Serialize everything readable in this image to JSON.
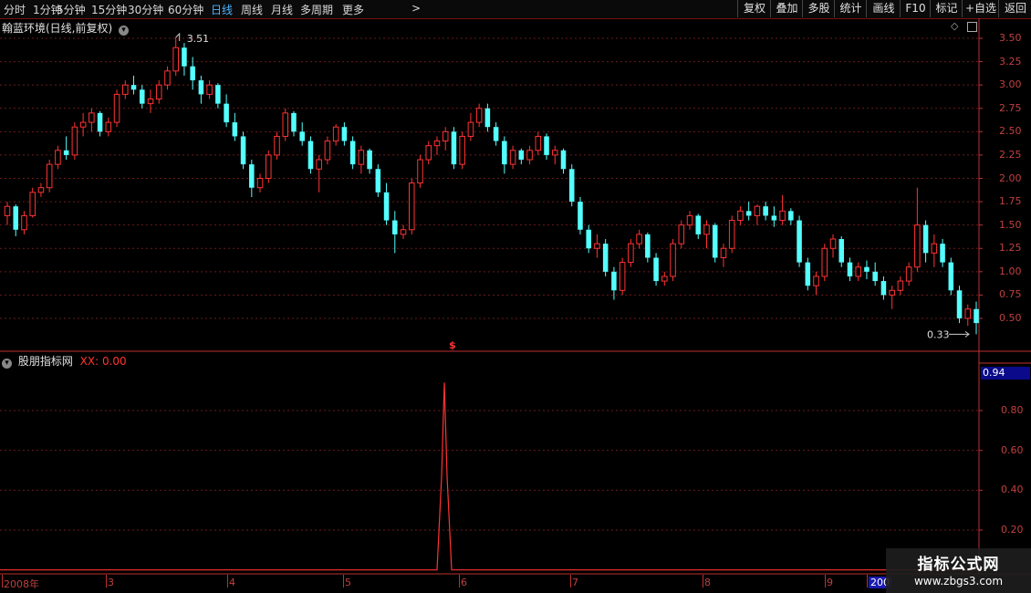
{
  "toolbar": {
    "periods": [
      {
        "label": "分时"
      },
      {
        "label": "1分钟"
      },
      {
        "label": "5分钟"
      },
      {
        "label": "15分钟"
      },
      {
        "label": "30分钟"
      },
      {
        "label": "60分钟"
      },
      {
        "label": "日线",
        "active": true
      },
      {
        "label": "周线"
      },
      {
        "label": "月线"
      },
      {
        "label": "多周期"
      },
      {
        "label": "更多"
      }
    ],
    "buttons": [
      "复权",
      "叠加",
      "多股",
      "统计",
      "画线",
      "F10",
      "标记",
      "+自选",
      "返回"
    ],
    "more_arrow": ">"
  },
  "main_chart": {
    "title": "翰蓝环境(日线,前复权)",
    "high_marker": "3.51",
    "low_marker": "0.33",
    "event_marker": "$",
    "axis_ticks": [
      "3.50",
      "3.25",
      "3.00",
      "2.75",
      "2.50",
      "2.25",
      "2.00",
      "1.75",
      "1.50",
      "1.25",
      "1.00",
      "0.75",
      "0.50"
    ]
  },
  "indicator": {
    "title": "股朋指标网",
    "xx_label": "XX: 0.00",
    "current_value": "0.94",
    "axis_ticks": [
      "0.80",
      "0.60",
      "0.40",
      "0.20"
    ]
  },
  "timeline": {
    "labels": [
      "2008年",
      "3",
      "4",
      "5",
      "6",
      "7",
      "8",
      "9",
      "200"
    ]
  },
  "watermark": {
    "title": "指标公式网",
    "url": "www.zbgs3.com"
  },
  "colors": {
    "up": "#ff3333",
    "down": "#54ffff",
    "grid": "#6b1a1a",
    "axis": "#c03030",
    "active_period": "#4fb3ff"
  },
  "chart_data": {
    "type": "candlestick",
    "price_range": [
      0.25,
      3.6
    ],
    "indicator_range": [
      0,
      1.0
    ],
    "indicator_peak": 0.94,
    "candles": [
      [
        1.6,
        1.75,
        1.5,
        1.7
      ],
      [
        1.7,
        1.72,
        1.38,
        1.45
      ],
      [
        1.45,
        1.65,
        1.4,
        1.6
      ],
      [
        1.6,
        1.9,
        1.58,
        1.85
      ],
      [
        1.85,
        1.95,
        1.8,
        1.9
      ],
      [
        1.9,
        2.2,
        1.85,
        2.15
      ],
      [
        2.15,
        2.35,
        2.1,
        2.3
      ],
      [
        2.3,
        2.45,
        2.2,
        2.25
      ],
      [
        2.25,
        2.6,
        2.2,
        2.55
      ],
      [
        2.55,
        2.7,
        2.45,
        2.6
      ],
      [
        2.6,
        2.75,
        2.5,
        2.7
      ],
      [
        2.7,
        2.72,
        2.45,
        2.5
      ],
      [
        2.5,
        2.65,
        2.45,
        2.6
      ],
      [
        2.6,
        2.95,
        2.55,
        2.9
      ],
      [
        2.9,
        3.05,
        2.85,
        3.0
      ],
      [
        3.0,
        3.1,
        2.9,
        2.95
      ],
      [
        2.95,
        3.0,
        2.75,
        2.8
      ],
      [
        2.8,
        2.95,
        2.7,
        2.85
      ],
      [
        2.85,
        3.05,
        2.8,
        3.0
      ],
      [
        3.0,
        3.2,
        2.95,
        3.15
      ],
      [
        3.15,
        3.51,
        3.1,
        3.4
      ],
      [
        3.4,
        3.45,
        3.1,
        3.2
      ],
      [
        3.2,
        3.3,
        2.95,
        3.05
      ],
      [
        3.05,
        3.1,
        2.8,
        2.9
      ],
      [
        2.9,
        3.05,
        2.85,
        3.0
      ],
      [
        3.0,
        3.02,
        2.75,
        2.8
      ],
      [
        2.8,
        2.9,
        2.55,
        2.6
      ],
      [
        2.6,
        2.7,
        2.4,
        2.45
      ],
      [
        2.45,
        2.5,
        2.1,
        2.15
      ],
      [
        2.15,
        2.2,
        1.8,
        1.9
      ],
      [
        1.9,
        2.05,
        1.85,
        2.0
      ],
      [
        2.0,
        2.3,
        1.95,
        2.25
      ],
      [
        2.25,
        2.5,
        2.2,
        2.45
      ],
      [
        2.45,
        2.75,
        2.4,
        2.7
      ],
      [
        2.7,
        2.72,
        2.45,
        2.5
      ],
      [
        2.5,
        2.6,
        2.35,
        2.4
      ],
      [
        2.4,
        2.45,
        2.05,
        2.1
      ],
      [
        2.1,
        2.25,
        1.85,
        2.2
      ],
      [
        2.2,
        2.45,
        2.15,
        2.4
      ],
      [
        2.4,
        2.58,
        2.35,
        2.55
      ],
      [
        2.55,
        2.6,
        2.35,
        2.4
      ],
      [
        2.4,
        2.45,
        2.1,
        2.15
      ],
      [
        2.15,
        2.35,
        2.05,
        2.3
      ],
      [
        2.3,
        2.32,
        2.05,
        2.1
      ],
      [
        2.1,
        2.15,
        1.8,
        1.85
      ],
      [
        1.85,
        1.95,
        1.5,
        1.55
      ],
      [
        1.55,
        1.65,
        1.2,
        1.4
      ],
      [
        1.4,
        1.5,
        1.35,
        1.45
      ],
      [
        1.45,
        2.0,
        1.4,
        1.95
      ],
      [
        1.95,
        2.25,
        1.9,
        2.2
      ],
      [
        2.2,
        2.4,
        2.15,
        2.35
      ],
      [
        2.35,
        2.45,
        2.25,
        2.4
      ],
      [
        2.4,
        2.55,
        2.3,
        2.5
      ],
      [
        2.5,
        2.55,
        2.1,
        2.15
      ],
      [
        2.15,
        2.5,
        2.1,
        2.45
      ],
      [
        2.45,
        2.7,
        2.4,
        2.6
      ],
      [
        2.6,
        2.8,
        2.55,
        2.75
      ],
      [
        2.75,
        2.8,
        2.5,
        2.55
      ],
      [
        2.55,
        2.6,
        2.35,
        2.4
      ],
      [
        2.4,
        2.45,
        2.05,
        2.15
      ],
      [
        2.15,
        2.35,
        2.1,
        2.3
      ],
      [
        2.3,
        2.32,
        2.15,
        2.2
      ],
      [
        2.2,
        2.35,
        2.15,
        2.3
      ],
      [
        2.3,
        2.5,
        2.25,
        2.45
      ],
      [
        2.45,
        2.48,
        2.2,
        2.25
      ],
      [
        2.25,
        2.35,
        2.15,
        2.3
      ],
      [
        2.3,
        2.32,
        2.05,
        2.1
      ],
      [
        2.1,
        2.15,
        1.7,
        1.75
      ],
      [
        1.75,
        1.8,
        1.4,
        1.45
      ],
      [
        1.45,
        1.5,
        1.2,
        1.25
      ],
      [
        1.25,
        1.4,
        1.15,
        1.3
      ],
      [
        1.3,
        1.35,
        0.95,
        1.0
      ],
      [
        1.0,
        1.05,
        0.7,
        0.8
      ],
      [
        0.8,
        1.15,
        0.75,
        1.1
      ],
      [
        1.1,
        1.35,
        1.05,
        1.3
      ],
      [
        1.3,
        1.45,
        1.25,
        1.4
      ],
      [
        1.4,
        1.42,
        1.1,
        1.15
      ],
      [
        1.15,
        1.2,
        0.85,
        0.9
      ],
      [
        0.9,
        1.0,
        0.85,
        0.95
      ],
      [
        0.95,
        1.35,
        0.9,
        1.3
      ],
      [
        1.3,
        1.55,
        1.25,
        1.5
      ],
      [
        1.5,
        1.65,
        1.45,
        1.6
      ],
      [
        1.6,
        1.62,
        1.35,
        1.4
      ],
      [
        1.4,
        1.55,
        1.25,
        1.5
      ],
      [
        1.5,
        1.52,
        1.1,
        1.15
      ],
      [
        1.15,
        1.3,
        1.05,
        1.25
      ],
      [
        1.25,
        1.6,
        1.2,
        1.55
      ],
      [
        1.55,
        1.7,
        1.5,
        1.65
      ],
      [
        1.65,
        1.75,
        1.55,
        1.6
      ],
      [
        1.6,
        1.72,
        1.5,
        1.7
      ],
      [
        1.7,
        1.75,
        1.55,
        1.6
      ],
      [
        1.6,
        1.7,
        1.48,
        1.55
      ],
      [
        1.55,
        1.82,
        1.5,
        1.65
      ],
      [
        1.65,
        1.68,
        1.5,
        1.55
      ],
      [
        1.55,
        1.6,
        1.05,
        1.1
      ],
      [
        1.1,
        1.15,
        0.8,
        0.85
      ],
      [
        0.85,
        1.0,
        0.75,
        0.95
      ],
      [
        0.95,
        1.3,
        0.9,
        1.25
      ],
      [
        1.25,
        1.4,
        1.15,
        1.35
      ],
      [
        1.35,
        1.38,
        1.05,
        1.1
      ],
      [
        1.1,
        1.15,
        0.9,
        0.95
      ],
      [
        0.95,
        1.1,
        0.9,
        1.05
      ],
      [
        1.05,
        1.12,
        0.92,
        1.0
      ],
      [
        1.0,
        1.1,
        0.85,
        0.9
      ],
      [
        0.9,
        0.95,
        0.7,
        0.75
      ],
      [
        0.75,
        0.85,
        0.6,
        0.8
      ],
      [
        0.8,
        0.95,
        0.75,
        0.9
      ],
      [
        0.9,
        1.1,
        0.85,
        1.05
      ],
      [
        1.05,
        1.9,
        1.0,
        1.5
      ],
      [
        1.5,
        1.55,
        1.1,
        1.2
      ],
      [
        1.2,
        1.4,
        1.05,
        1.3
      ],
      [
        1.3,
        1.35,
        1.05,
        1.1
      ],
      [
        1.1,
        1.15,
        0.75,
        0.8
      ],
      [
        0.8,
        0.85,
        0.45,
        0.5
      ],
      [
        0.5,
        0.65,
        0.42,
        0.6
      ],
      [
        0.6,
        0.68,
        0.33,
        0.45
      ]
    ]
  }
}
